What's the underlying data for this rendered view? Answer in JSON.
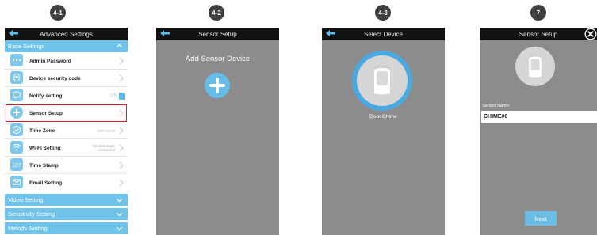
{
  "steps": {
    "s1": "4-1",
    "s2": "4-2",
    "s3": "4-3",
    "s4": "7"
  },
  "screen1": {
    "title": "Advanced Settings",
    "section_base": "Base Settings",
    "items": [
      {
        "label": "Admin Password",
        "icon": "dots-icon"
      },
      {
        "label": "Device security code",
        "icon": "lock-icon"
      },
      {
        "label": "Notify setting",
        "icon": "chat-icon",
        "toggle": "ON"
      },
      {
        "label": "Sensor Setup",
        "icon": "plus-circle-icon"
      },
      {
        "label": "Time Zone",
        "icon": "check-circle-icon",
        "value": "GMT+08:00"
      },
      {
        "label": "Wi-Fi Setting",
        "icon": "wifi-icon",
        "value": "TpLinkNetCam Connected"
      },
      {
        "label": "Time Stamp",
        "icon": "time-icon"
      },
      {
        "label": "Email Setting",
        "icon": "mail-icon"
      }
    ],
    "section_video": "Video Setting",
    "section_sensitivity": "Sensitivity Setting",
    "section_melody": "Melody Setting"
  },
  "screen2": {
    "title": "Sensor Setup",
    "add_label": "Add Sensor Device"
  },
  "screen3": {
    "title": "Select Device",
    "device_label": "Door Chime"
  },
  "screen4": {
    "title": "Sensor Setup",
    "name_label": "Sensor Name:",
    "name_value": "CHIME#0",
    "next_label": "Next"
  },
  "colors": {
    "accent": "#6fc3ea",
    "titlebar": "#111111",
    "screen_gray": "#8c8c8c",
    "highlight": "#d92027"
  }
}
